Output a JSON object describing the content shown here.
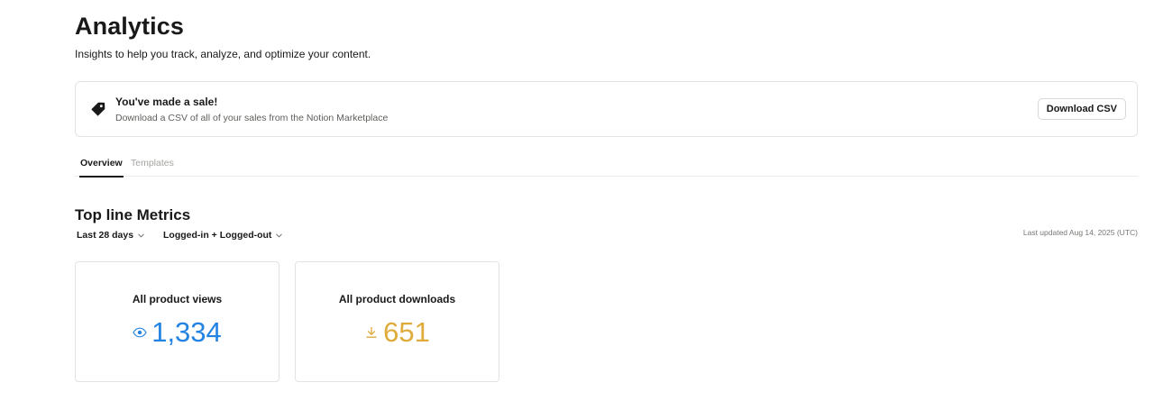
{
  "header": {
    "title": "Analytics",
    "subtitle": "Insights to help you track, analyze, and optimize your content."
  },
  "banner": {
    "icon": "tag-icon",
    "title": "You've made a sale!",
    "subtitle": "Download a CSV of all of your sales from the Notion Marketplace",
    "button_label": "Download CSV"
  },
  "tabs": [
    {
      "label": "Overview",
      "active": true
    },
    {
      "label": "Templates",
      "active": false
    }
  ],
  "metrics": {
    "section_title": "Top line Metrics",
    "filters": {
      "date_range": "Last 28 days",
      "audience": "Logged-in + Logged-out"
    },
    "last_updated": "Last updated Aug 14, 2025 (UTC)",
    "cards": [
      {
        "label": "All product views",
        "value": "1,334",
        "icon": "eye-icon",
        "color": "#2383e2"
      },
      {
        "label": "All product downloads",
        "value": "651",
        "icon": "download-icon",
        "color": "#dfab3b"
      }
    ]
  }
}
